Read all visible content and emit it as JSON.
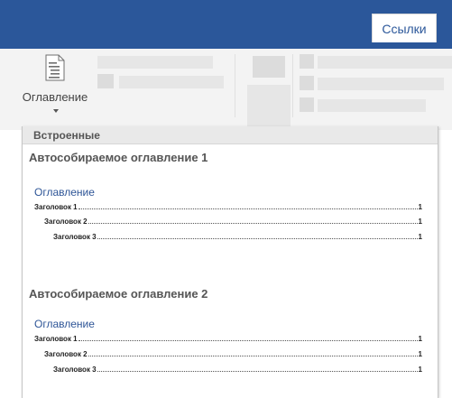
{
  "ribbon": {
    "active_tab": "Ссылки",
    "toc_button_label": "Оглавление",
    "colors": {
      "bar": "#2b579a",
      "body": "#f3f3f3"
    }
  },
  "gallery": {
    "header": "Встроенные",
    "sections": [
      {
        "title": "Автособираемое оглавление 1",
        "toc_heading": "Оглавление",
        "entries": [
          {
            "text": "Заголовок 1",
            "page": "1"
          },
          {
            "text": "Заголовок 2",
            "page": "1"
          },
          {
            "text": "Заголовок 3",
            "page": "1"
          }
        ]
      },
      {
        "title": "Автособираемое оглавление 2",
        "toc_heading": "Оглавление",
        "entries": [
          {
            "text": "Заголовок 1",
            "page": "1"
          },
          {
            "text": "Заголовок 2",
            "page": "1"
          },
          {
            "text": "Заголовок 3",
            "page": "1"
          }
        ]
      }
    ]
  }
}
